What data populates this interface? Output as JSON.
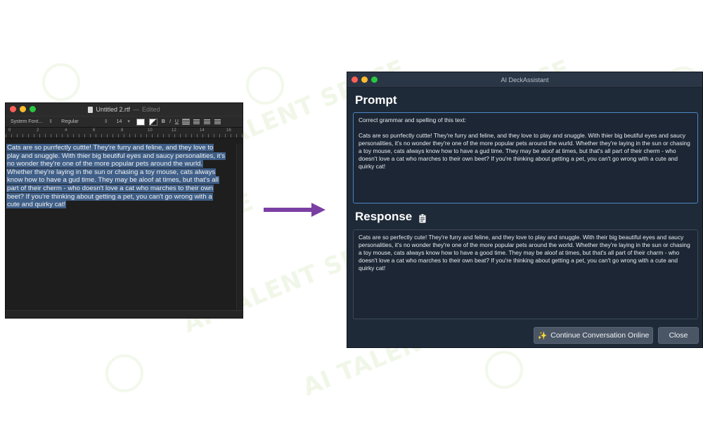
{
  "watermark": {
    "text": "AI TALENT SPACE"
  },
  "textedit": {
    "doc_title": "Untitled 2.rtf",
    "separator": "—",
    "status": "Edited",
    "font_family": "System Font…",
    "font_style": "Regular",
    "font_size": "14",
    "bold": "B",
    "italic": "I",
    "underline": "U",
    "ruler_marks": [
      "0",
      "2",
      "4",
      "6",
      "8",
      "10",
      "12",
      "14",
      "16"
    ],
    "body_lines": [
      "Cats are so purrfectly cuttte! They're furry and feline, and they love to",
      "play and snuggle. With thier big beutiful eyes and saucy personalities, it's",
      "no wonder they're one of the more popular pets around the wurld.",
      "Whether they're laying in the sun or chasing a toy mouse, cats always",
      "know how to have a gud time. They may be aloof at times, but that's all",
      "part of their cherm - who doesn't love a cat who marches to their own",
      "beet? If you're thinking about getting a pet, you can't go wrong with a",
      "cute and quirky cat!"
    ]
  },
  "assistant": {
    "window_title": "AI DeckAssistant",
    "prompt_heading": "Prompt",
    "prompt_text": "Correct grammar and spelling of this text:\n\nCats are so purrfectly cuttte! They're furry and feline, and they love to play and snuggle. With thier big beutiful eyes and saucy personalities, it's no wonder they're one of the more popular pets around the wurld. Whether they're laying in the sun or chasing a toy mouse, cats always know how to have a gud time. They may be aloof at times, but that's all part of their cherm - who doesn't love a cat who marches to their own beet? If you're thinking about getting a pet, you can't go wrong with a cute and quirky cat!",
    "response_heading": "Response",
    "response_text": "Cats are so perfectly cute! They're furry and feline, and they love to play and snuggle. With their big beautiful eyes and saucy personalities, it's no wonder they're one of the more popular pets around the world. Whether they're laying in the sun or chasing a toy mouse, cats always know how to have a good time. They may be aloof at times, but that's all part of their charm - who doesn't love a cat who marches to their own beat? If you're thinking about getting a pet, you can't go wrong with a cute and quirky cat!",
    "continue_button": "Continue Conversation Online",
    "close_button": "Close"
  },
  "colors": {
    "selection": "#3f5f88",
    "arrow": "#7a3fa3",
    "prompt_focus_border": "#4d86c4",
    "assistant_bg": "#1f2a38"
  }
}
